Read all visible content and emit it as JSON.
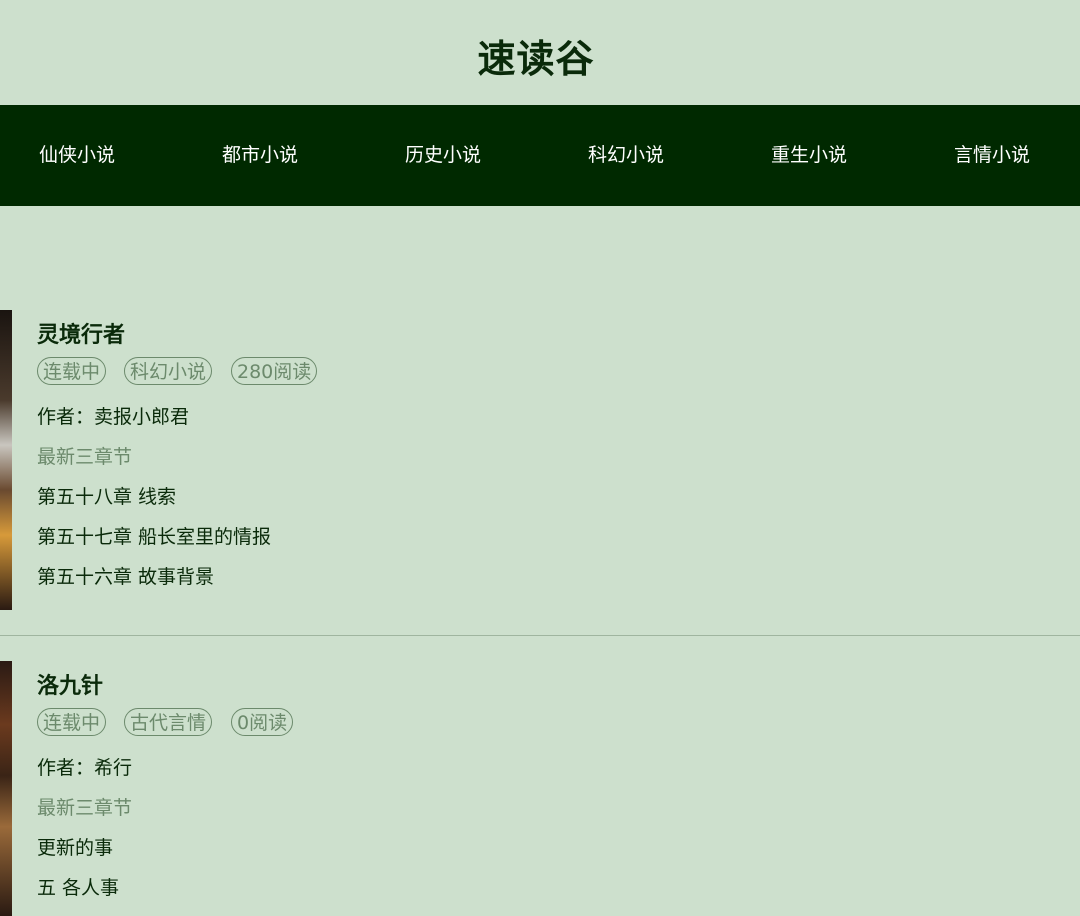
{
  "site": {
    "title": "速读谷"
  },
  "nav": {
    "items": [
      {
        "label": "仙侠小说"
      },
      {
        "label": "都市小说"
      },
      {
        "label": "历史小说"
      },
      {
        "label": "科幻小说"
      },
      {
        "label": "重生小说"
      },
      {
        "label": "言情小说"
      }
    ]
  },
  "books": [
    {
      "title": "灵境行者",
      "tags": [
        "连载中",
        "科幻小说",
        "280阅读"
      ],
      "author_label": "作者：",
      "author": "卖报小郎君",
      "latest_label": "最新三章节",
      "chapters": [
        "第五十八章 线索",
        "第五十七章 船长室里的情报",
        "第五十六章 故事背景"
      ]
    },
    {
      "title": "洛九针",
      "tags": [
        "连载中",
        "古代言情",
        "0阅读"
      ],
      "author_label": "作者：",
      "author": "希行",
      "latest_label": "最新三章节",
      "chapters": [
        "更新的事",
        "五 各人事"
      ]
    }
  ],
  "colors": {
    "background": "#cde0cd",
    "nav_background": "#002900",
    "title_text": "#0a2a0a",
    "muted_text": "#6c8a6c"
  }
}
